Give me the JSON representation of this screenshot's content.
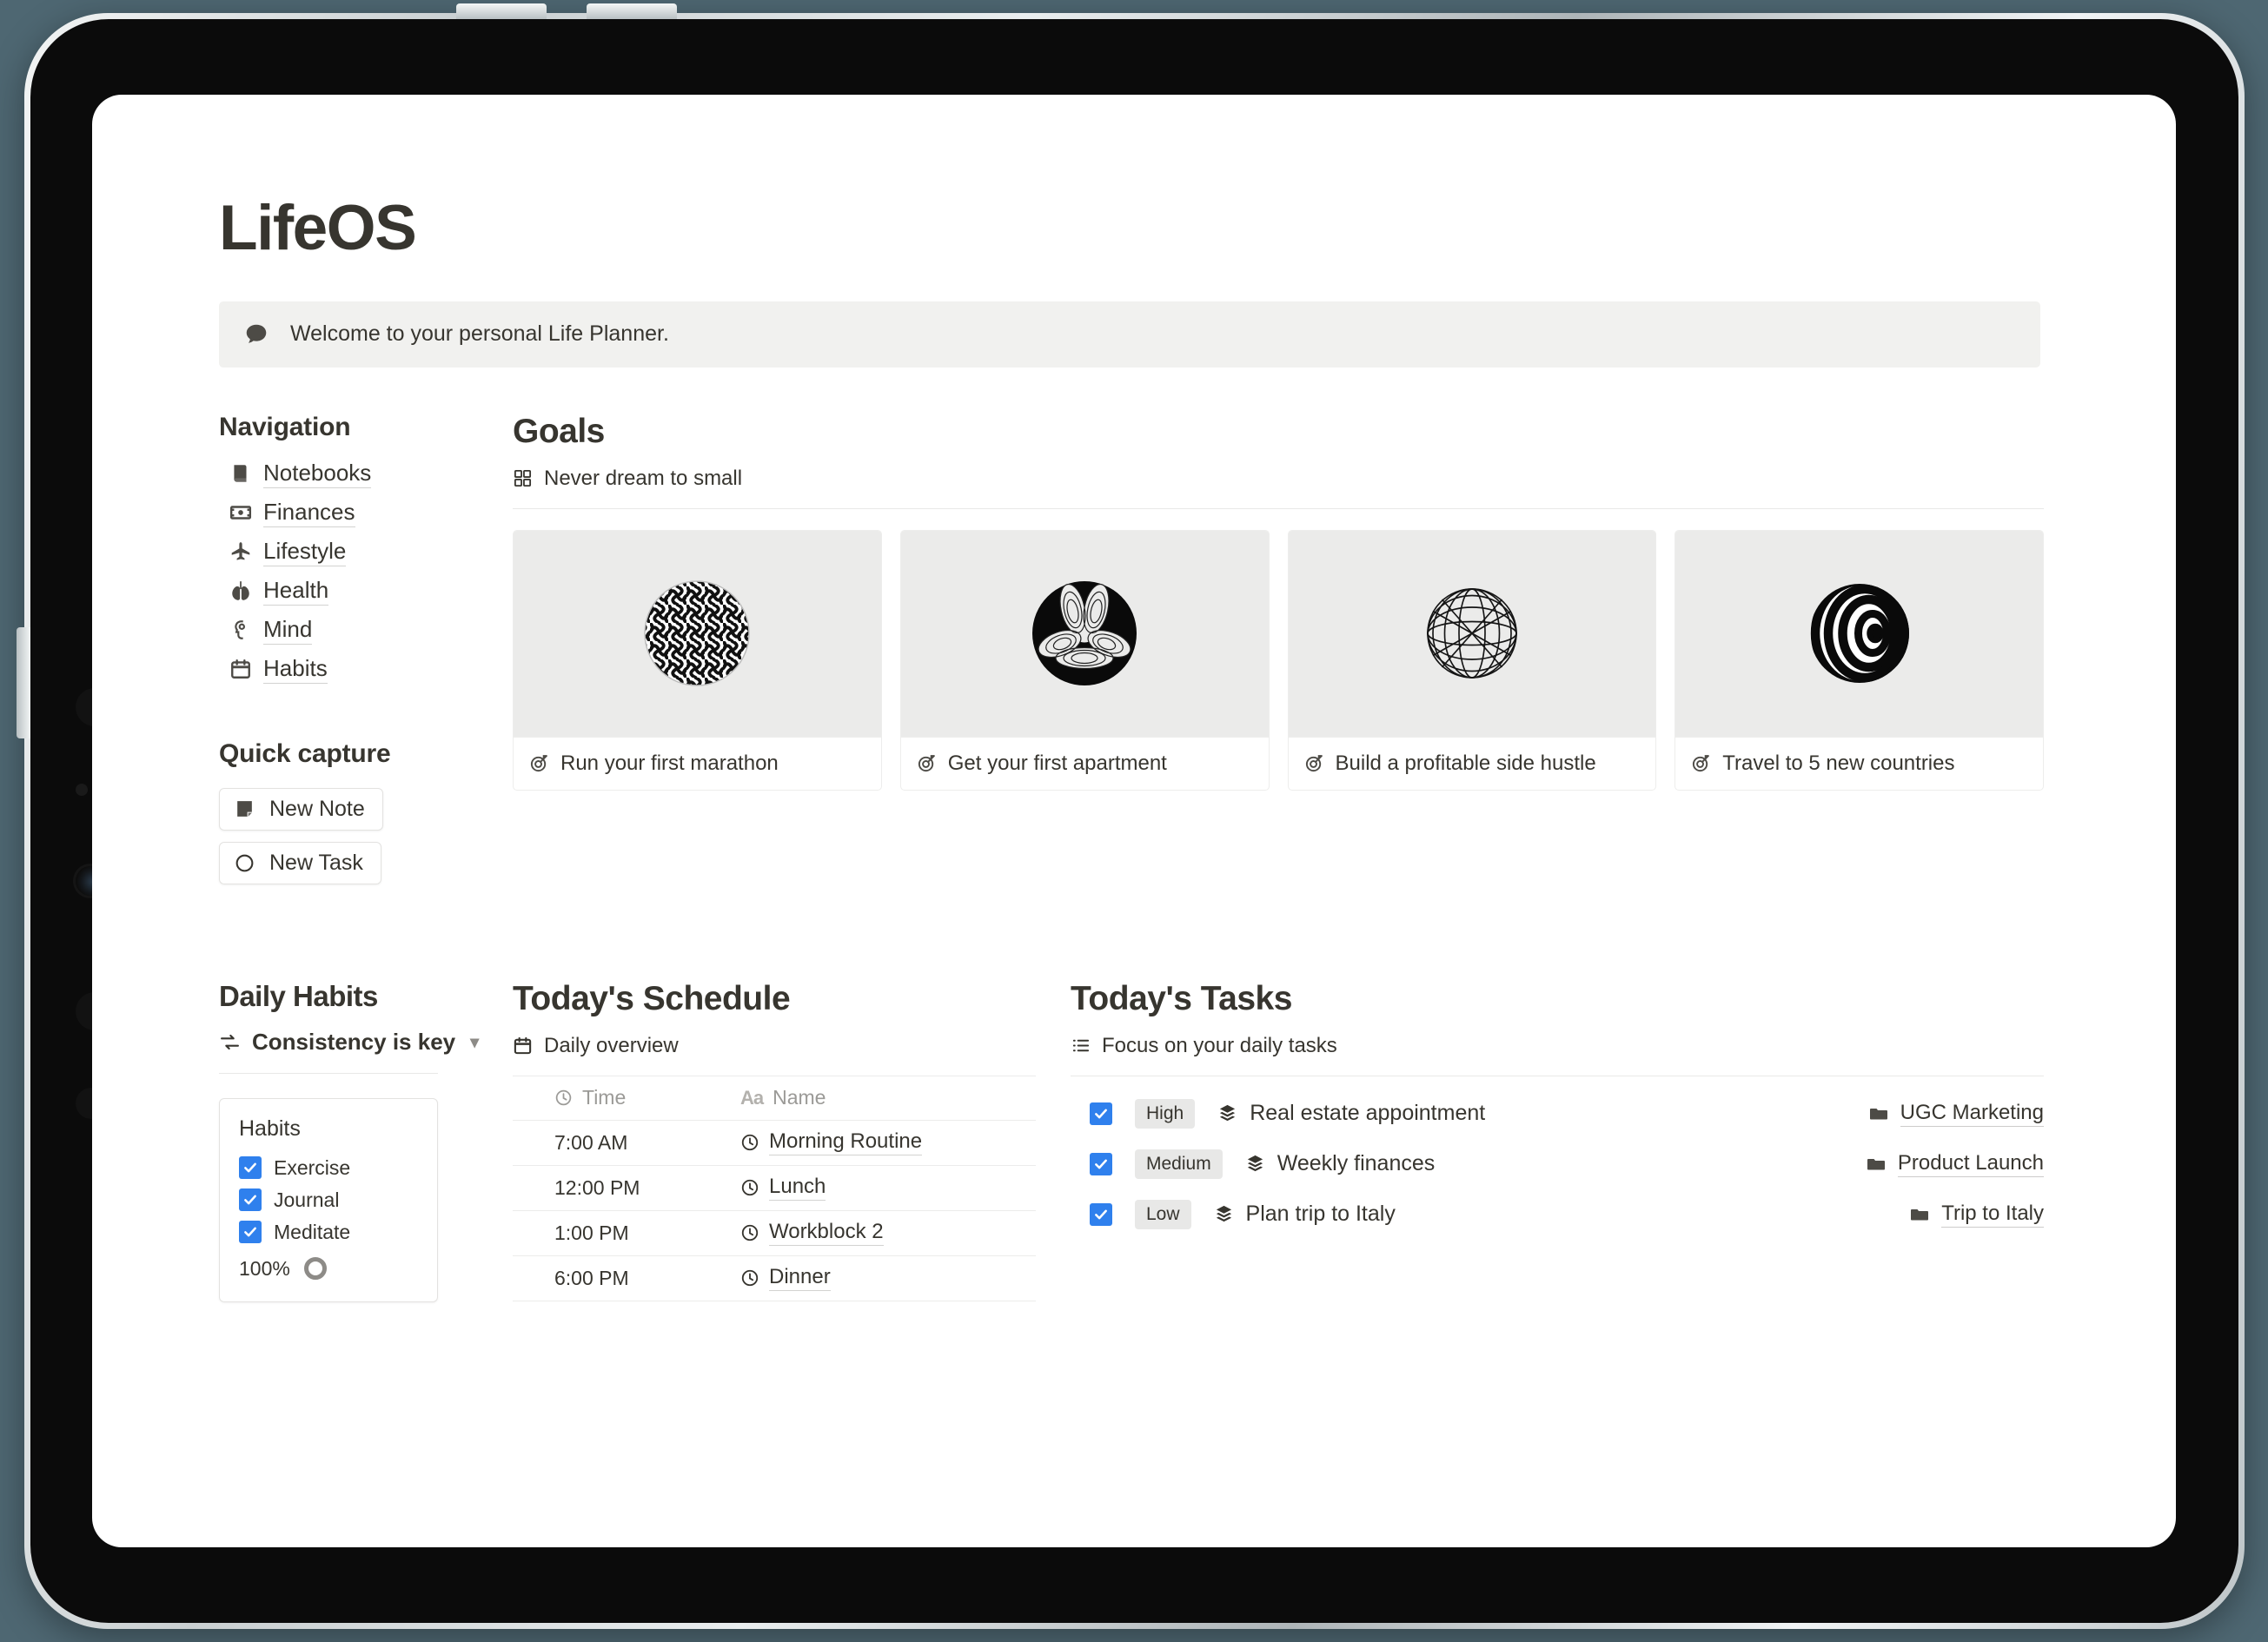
{
  "page": {
    "title": "LifeOS",
    "callout": {
      "icon": "speech-bubble-icon",
      "text": "Welcome to your personal Life Planner."
    }
  },
  "navigation": {
    "heading": "Navigation",
    "items": [
      {
        "label": "Notebooks",
        "icon": "notebook-icon"
      },
      {
        "label": "Finances",
        "icon": "money-icon"
      },
      {
        "label": "Lifestyle",
        "icon": "airplane-icon"
      },
      {
        "label": "Health",
        "icon": "lungs-icon"
      },
      {
        "label": "Mind",
        "icon": "head-icon"
      },
      {
        "label": "Habits",
        "icon": "calendar-icon"
      }
    ]
  },
  "quick_capture": {
    "heading": "Quick capture",
    "buttons": [
      {
        "label": "New Note",
        "icon": "note-icon"
      },
      {
        "label": "New Task",
        "icon": "circle-icon"
      }
    ]
  },
  "goals": {
    "heading": "Goals",
    "subtitle": "Never dream to small",
    "subtitle_icon": "gallery-view-icon",
    "cards": [
      {
        "label": "Run your first marathon",
        "icon": "target-icon",
        "art": "maze-sphere"
      },
      {
        "label": "Get your first apartment",
        "icon": "target-icon",
        "art": "clover-sphere"
      },
      {
        "label": "Build a profitable side hustle",
        "icon": "target-icon",
        "art": "wireframe-globe"
      },
      {
        "label": "Travel to 5 new countries",
        "icon": "target-icon",
        "art": "rings-sphere"
      }
    ]
  },
  "daily_habits": {
    "heading": "Daily Habits",
    "subtitle": "Consistency is key",
    "subtitle_icon": "sync-icon",
    "card_title": "Habits",
    "items": [
      {
        "label": "Exercise",
        "checked": true
      },
      {
        "label": "Journal",
        "checked": true
      },
      {
        "label": "Meditate",
        "checked": true
      }
    ],
    "progress": "100%"
  },
  "schedule": {
    "heading": "Today's Schedule",
    "subtitle": "Daily overview",
    "subtitle_icon": "calendar-icon",
    "columns": [
      {
        "label": "Time",
        "icon": "clock-icon"
      },
      {
        "label": "Name",
        "icon": "text-aa-icon"
      }
    ],
    "rows": [
      {
        "time": "7:00 AM",
        "name": "Morning Routine",
        "icon": "clock-icon"
      },
      {
        "time": "12:00 PM",
        "name": "Lunch",
        "icon": "clock-icon"
      },
      {
        "time": "1:00 PM",
        "name": "Workblock 2",
        "icon": "clock-icon"
      },
      {
        "time": "6:00 PM",
        "name": "Dinner",
        "icon": "clock-icon"
      }
    ]
  },
  "tasks": {
    "heading": "Today's Tasks",
    "subtitle": "Focus on your daily tasks",
    "subtitle_icon": "list-view-icon",
    "rows": [
      {
        "checked": true,
        "priority": "High",
        "name": "Real estate appointment",
        "project": "UGC Marketing",
        "icon": "stack-icon",
        "project_icon": "folder-icon"
      },
      {
        "checked": true,
        "priority": "Medium",
        "name": "Weekly finances",
        "project": "Product Launch",
        "icon": "stack-icon",
        "project_icon": "folder-icon"
      },
      {
        "checked": true,
        "priority": "Low",
        "name": "Plan trip to Italy",
        "project": "Trip to Italy",
        "icon": "stack-icon",
        "project_icon": "folder-icon"
      }
    ]
  },
  "colors": {
    "accent_blue": "#2f80ed",
    "text": "#37352f",
    "muted": "#9b9a97",
    "callout_bg": "#f1f1ef",
    "cover_bg": "#ebebea",
    "tag_bg": "#e8e8e7",
    "page_bg": "#ffffff",
    "desktop_bg": "#4e6772"
  }
}
